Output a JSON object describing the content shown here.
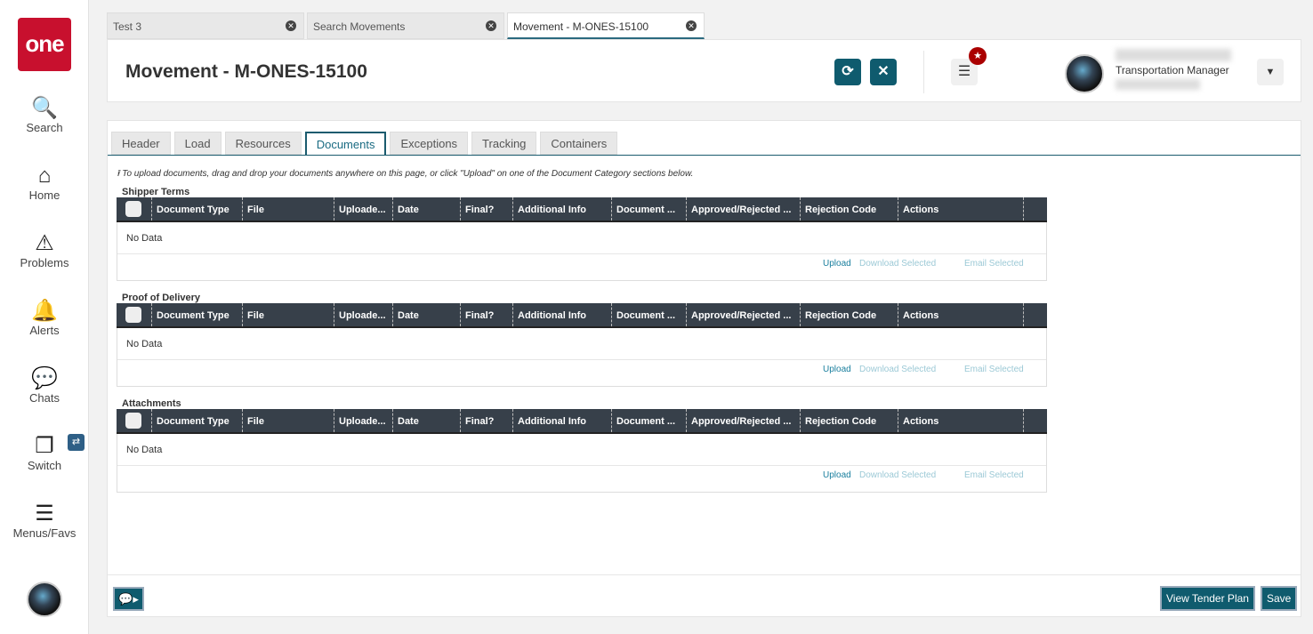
{
  "sidebar": {
    "logo": "one",
    "items": [
      {
        "label": "Search",
        "icon": "🔍"
      },
      {
        "label": "Home",
        "icon": "⌂"
      },
      {
        "label": "Problems",
        "icon": "⚠"
      },
      {
        "label": "Alerts",
        "icon": "🔔"
      },
      {
        "label": "Chats",
        "icon": "💬"
      },
      {
        "label": "Switch",
        "icon": "❐"
      },
      {
        "label": "Menus/Favs",
        "icon": "☰"
      }
    ],
    "switch_badge": "⇄"
  },
  "tabs": [
    {
      "label": "Test 3"
    },
    {
      "label": "Search Movements"
    },
    {
      "label": "Movement - M-ONES-15100"
    }
  ],
  "header": {
    "title": "Movement - M-ONES-15100",
    "role": "Transportation Manager"
  },
  "subtabs": [
    "Header",
    "Load",
    "Resources",
    "Documents",
    "Exceptions",
    "Tracking",
    "Containers"
  ],
  "hint": "To upload documents, drag and drop your documents anywhere on this page, or click \"Upload\" on one of the Document Category sections below.",
  "columns": [
    "Document Type",
    "File",
    "Uploade...",
    "Date",
    "Final?",
    "Additional Info",
    "Document ...",
    "Approved/Rejected ...",
    "Rejection Code",
    "Actions"
  ],
  "sections": [
    {
      "title": "Shipper Terms"
    },
    {
      "title": "Proof of Delivery"
    },
    {
      "title": "Attachments"
    }
  ],
  "table": {
    "empty": "No Data",
    "upload": "Upload",
    "download": "Download Selected",
    "email": "Email Selected"
  },
  "footer": {
    "view_tender": "View Tender Plan",
    "save": "Save"
  }
}
